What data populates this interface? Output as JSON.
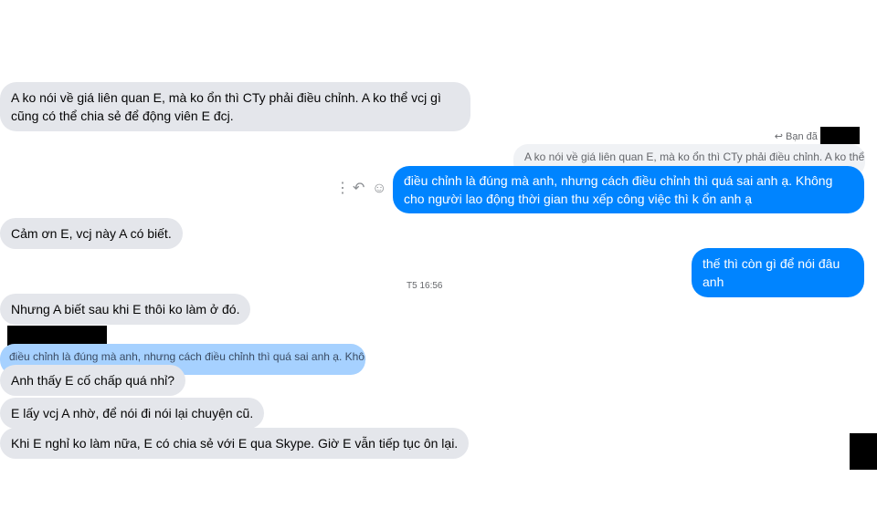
{
  "messages": {
    "m1": "A ko nói về giá liên quan E, mà ko ổn thì CTy phải điều chỉnh. A ko thể vcj gì cũng có thể chia sẻ để động viên E đcj.",
    "reply_label": "Bạn đã t",
    "reply_quote": "A ko nói về giá liên quan E, mà ko ổn thì CTy phải điều chỉnh. A ko thể ...",
    "m2": "điều chỉnh là đúng mà anh, nhưng cách điều chỉnh thì quá sai anh ạ. Không cho người lao động thời gian thu xếp công việc  thì k ổn anh ạ",
    "m3": "Cảm ơn E, vcj này A có biết.",
    "m4": "thế thì còn gì để nói đâu anh",
    "timestamp": "T5 16:56",
    "m5": "Nhưng A biết sau khi E thôi ko làm ở đó.",
    "reply_quote_2": "điều chỉnh là đúng mà anh, nhưng cách điều chỉnh thì quá sai anh ạ. Khôn...",
    "m6": "Anh thấy E cố chấp quá nhỉ?",
    "m7": "E lấy vcj A nhờ, để nói đi nói lại chuyện cũ.",
    "m8": "Khi E nghỉ ko làm nữa, E có chia sẻ với E qua Skype. Giờ  E vẫn tiếp tục ôn lại."
  },
  "icons": {
    "more": "more-vertical-icon",
    "reply": "reply-icon",
    "react": "smiley-icon"
  },
  "colors": {
    "incoming": "#e4e6eb",
    "outgoing": "#0084ff"
  }
}
